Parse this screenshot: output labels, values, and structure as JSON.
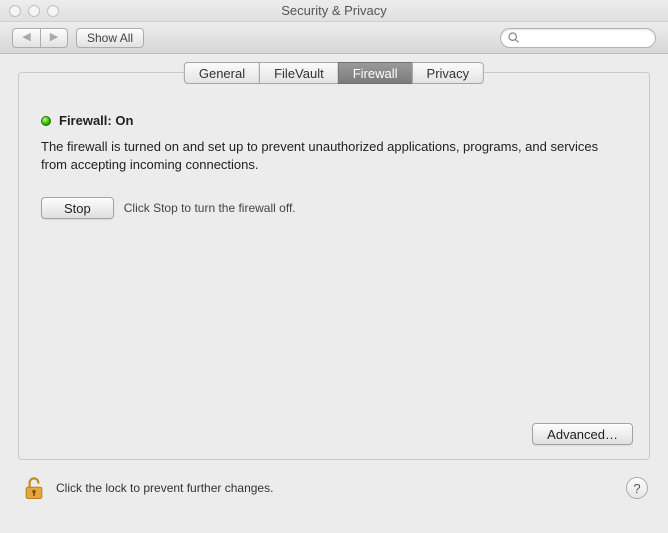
{
  "window": {
    "title": "Security & Privacy"
  },
  "toolbar": {
    "show_all": "Show All",
    "search_placeholder": ""
  },
  "tabs": [
    {
      "label": "General",
      "active": false
    },
    {
      "label": "FileVault",
      "active": false
    },
    {
      "label": "Firewall",
      "active": true
    },
    {
      "label": "Privacy",
      "active": false
    }
  ],
  "firewall": {
    "status_label": "Firewall: On",
    "description": "The firewall is turned on and set up to prevent unauthorized applications, programs, and services from accepting incoming connections.",
    "stop_button": "Stop",
    "stop_hint": "Click Stop to turn the firewall off.",
    "advanced_button": "Advanced…"
  },
  "footer": {
    "lock_text": "Click the lock to prevent further changes.",
    "help": "?"
  }
}
